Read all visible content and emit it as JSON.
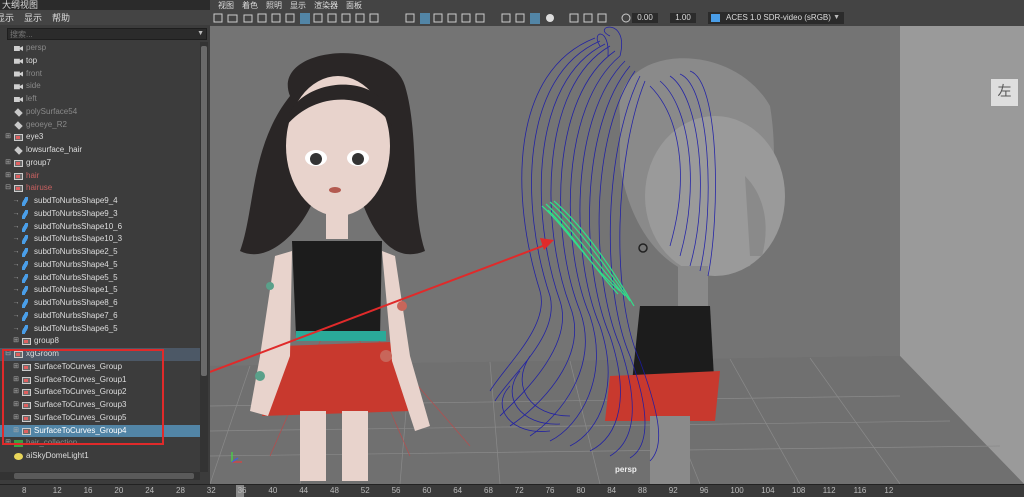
{
  "outliner": {
    "title": "大纲视图",
    "menu": [
      "显示",
      "显示",
      "帮助"
    ],
    "search_placeholder": "搜索...",
    "items": [
      {
        "label": "persp",
        "icon": "camera-icon",
        "style": "dim",
        "indent": 0
      },
      {
        "label": "top",
        "icon": "camera-icon",
        "style": "normal",
        "indent": 0
      },
      {
        "label": "front",
        "icon": "camera-icon",
        "style": "dim",
        "indent": 0
      },
      {
        "label": "side",
        "icon": "camera-icon",
        "style": "dim",
        "indent": 0
      },
      {
        "label": "left",
        "icon": "camera-icon",
        "style": "dim",
        "indent": 0
      },
      {
        "label": "polySurface54",
        "icon": "mesh-icon",
        "style": "dim",
        "indent": 0
      },
      {
        "label": "geoeye_R2",
        "icon": "mesh-icon",
        "style": "dim",
        "indent": 0
      },
      {
        "label": "eye3",
        "icon": "group-icon",
        "style": "normal",
        "indent": 0,
        "expand": "+"
      },
      {
        "label": "lowsurface_hair",
        "icon": "mesh-icon",
        "style": "normal",
        "indent": 0
      },
      {
        "label": "group7",
        "icon": "group-icon",
        "style": "normal",
        "indent": 0,
        "expand": "+"
      },
      {
        "label": "hair",
        "icon": "group-icon",
        "style": "red",
        "indent": 0,
        "expand": "+"
      },
      {
        "label": "hairuse",
        "icon": "group-icon",
        "style": "red",
        "indent": 0,
        "expand": "-"
      },
      {
        "label": "subdToNurbsShape9_4",
        "icon": "curve-icon",
        "style": "normal",
        "indent": 1
      },
      {
        "label": "subdToNurbsShape9_3",
        "icon": "curve-icon",
        "style": "normal",
        "indent": 1
      },
      {
        "label": "subdToNurbsShape10_6",
        "icon": "curve-icon",
        "style": "normal",
        "indent": 1
      },
      {
        "label": "subdToNurbsShape10_3",
        "icon": "curve-icon",
        "style": "normal",
        "indent": 1
      },
      {
        "label": "subdToNurbsShape2_5",
        "icon": "curve-icon",
        "style": "normal",
        "indent": 1
      },
      {
        "label": "subdToNurbsShape4_5",
        "icon": "curve-icon",
        "style": "normal",
        "indent": 1
      },
      {
        "label": "subdToNurbsShape5_5",
        "icon": "curve-icon",
        "style": "normal",
        "indent": 1
      },
      {
        "label": "subdToNurbsShape1_5",
        "icon": "curve-icon",
        "style": "normal",
        "indent": 1
      },
      {
        "label": "subdToNurbsShape8_6",
        "icon": "curve-icon",
        "style": "normal",
        "indent": 1
      },
      {
        "label": "subdToNurbsShape7_6",
        "icon": "curve-icon",
        "style": "normal",
        "indent": 1
      },
      {
        "label": "subdToNurbsShape6_5",
        "icon": "curve-icon",
        "style": "normal",
        "indent": 1
      },
      {
        "label": "group8",
        "icon": "group-icon",
        "style": "normal",
        "indent": 1,
        "expand": "+"
      },
      {
        "label": "xgGroom",
        "icon": "group-icon",
        "style": "hl",
        "indent": 0,
        "expand": "-"
      },
      {
        "label": "SurfaceToCurves_Group",
        "icon": "group-icon",
        "style": "normal",
        "indent": 1,
        "expand": "+"
      },
      {
        "label": "SurfaceToCurves_Group1",
        "icon": "group-icon",
        "style": "normal",
        "indent": 1,
        "expand": "+"
      },
      {
        "label": "SurfaceToCurves_Group2",
        "icon": "group-icon",
        "style": "normal",
        "indent": 1,
        "expand": "+"
      },
      {
        "label": "SurfaceToCurves_Group3",
        "icon": "group-icon",
        "style": "normal",
        "indent": 1,
        "expand": "+"
      },
      {
        "label": "SurfaceToCurves_Group5",
        "icon": "group-icon",
        "style": "normal",
        "indent": 1,
        "expand": "+"
      },
      {
        "label": "SurfaceToCurves_Group4",
        "icon": "group-icon",
        "style": "sel",
        "indent": 1,
        "expand": "+"
      },
      {
        "label": "hair_collection",
        "icon": "xgen-icon",
        "style": "dim",
        "indent": 0,
        "expand": "+"
      },
      {
        "label": "aiSkyDomeLight1",
        "icon": "light-icon",
        "style": "normal",
        "indent": 0
      }
    ]
  },
  "viewport": {
    "menu": [
      "视图",
      "着色",
      "照明",
      "显示",
      "渲染器",
      "面板"
    ],
    "toolbar": {
      "exposure_value": "0.00",
      "gamma_value": "1.00",
      "color_management": "ACES 1.0 SDR-video (sRGB)"
    },
    "camera_label": "persp",
    "view_cube_label": "左"
  },
  "timeline": {
    "ticks": [
      "8",
      "12",
      "16",
      "20",
      "24",
      "28",
      "32",
      "36",
      "40",
      "44",
      "48",
      "52",
      "56",
      "60",
      "64",
      "68",
      "72",
      "76",
      "80",
      "84",
      "88",
      "92",
      "96",
      "100",
      "104",
      "108",
      "112",
      "116",
      "12"
    ]
  },
  "colors": {
    "selection": "#5285a6",
    "annotation_red": "#e02a2a",
    "curve_blue": "#1a1aa8",
    "guide_green": "#2fe08a"
  }
}
